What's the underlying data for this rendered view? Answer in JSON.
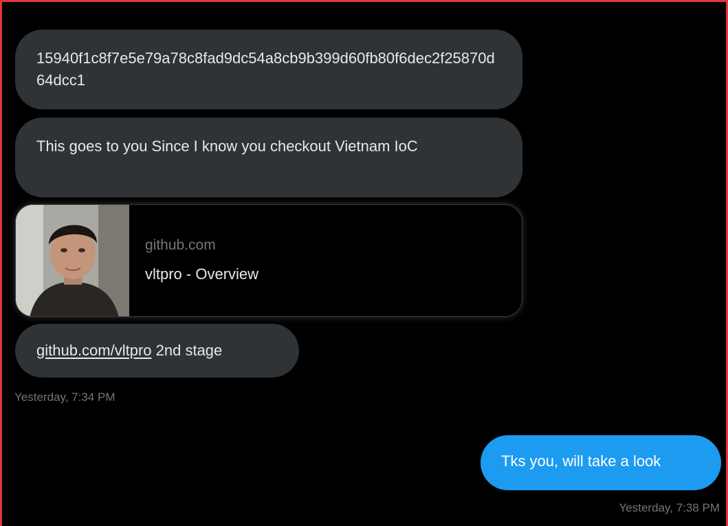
{
  "conversation": {
    "messages_in": [
      {
        "text": "15940f1c8f7e5e79a78c8fad9dc54a8cb9b399d60fb80f6dec2f25870d64dcc1"
      },
      {
        "text": "This goes to you Since I know you checkout Vietnam IoC"
      }
    ],
    "link_card": {
      "domain": "github.com",
      "title": "vltpro - Overview",
      "thumbnail": "profile-photo"
    },
    "link_message": {
      "link_text": "github.com/vltpro",
      "trailing_text": " 2nd stage"
    },
    "timestamp_in": "Yesterday, 7:34 PM",
    "message_out": {
      "text": "Tks you, will take a look"
    },
    "timestamp_out": "Yesterday, 7:38 PM"
  },
  "colors": {
    "background": "#000000",
    "incoming_bubble": "#2f3336",
    "outgoing_bubble": "#1d9bf0",
    "frame_border": "#e0353f",
    "muted_text": "#71767b"
  }
}
